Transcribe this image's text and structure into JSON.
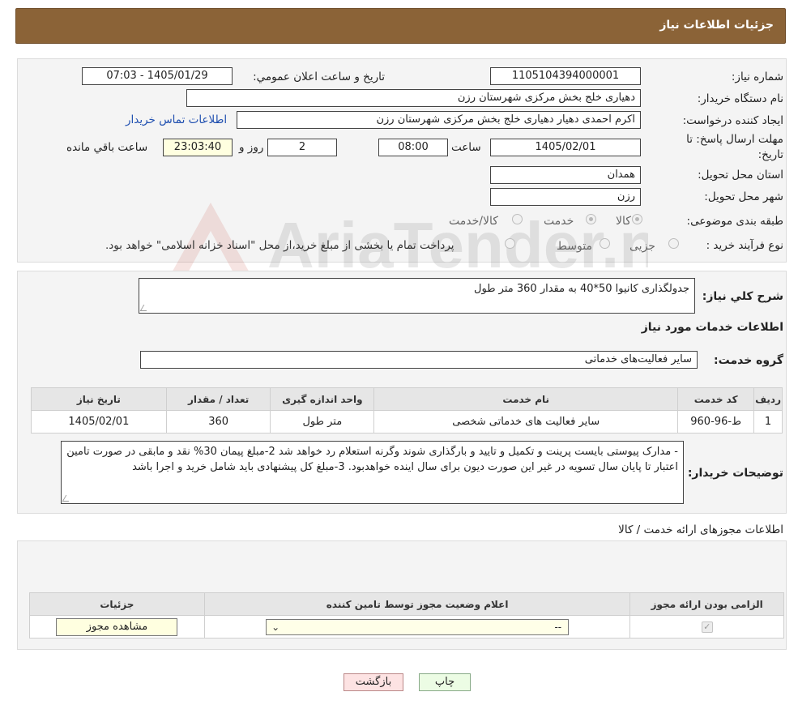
{
  "header": {
    "title": "جزئیات اطلاعات نیاز"
  },
  "form": {
    "need_number_label": "شماره نیاز:",
    "need_number": "1105104394000001",
    "announce_label": "تاریخ و ساعت اعلان عمومي:",
    "announce_value": "1405/01/29 - 07:03",
    "buyer_org_label": "نام دستگاه خريدار:",
    "buyer_org": "دهیاری خلج بخش مرکزی شهرستان رزن",
    "requester_label": "ايجاد کننده درخواست:",
    "requester": "اکرم احمدی دهیار دهیاری خلج بخش مرکزی شهرستان رزن",
    "contact_link": "اطلاعات تماس خریدار",
    "deadline_label_line1": "مهلت ارسال پاسخ: تا",
    "deadline_label_line2": "تاريخ:",
    "deadline_date": "1405/02/01",
    "hour_label": "ساعت",
    "deadline_time": "08:00",
    "days_value": "2",
    "days_label": "روز و",
    "remaining_time": "23:03:40",
    "remaining_label": "ساعت باقي مانده",
    "province_label": "استان محل تحويل:",
    "province": "همدان",
    "city_label": "شهر محل تحويل:",
    "city": "رزن",
    "category_label": "طبقه بندی موضوعی:",
    "category_options": [
      "کالا",
      "خدمت",
      "کالا/خدمت"
    ],
    "process_label": "نوع فرآيند خريد :",
    "process_options": [
      "جزیی",
      "متوسط"
    ],
    "process_note": "پرداخت تمام یا بخشی از مبلغ خرید،از محل \"اسناد خزانه اسلامی\" خواهد بود."
  },
  "details": {
    "summary_label": "شرح کلي نياز:",
    "summary": "جدولگذاری کانیوا 50*40 به مقدار 360 متر طول",
    "services_title": "اطلاعات خدمات مورد نياز",
    "service_group_label": "گروه خدمت:",
    "service_group": "ساير فعاليت‌هاى خدماتى",
    "table": {
      "headers": [
        "رديف",
        "کد خدمت",
        "نام خدمت",
        "واحد اندازه گيری",
        "تعداد / مقدار",
        "تاريخ نياز"
      ],
      "rows": [
        [
          "1",
          "ط-96-960",
          "سایر فعالیت های خدماتی شخصی",
          "متر طول",
          "360",
          "1405/02/01"
        ]
      ]
    },
    "buyer_notes_label": "توضيحات خريدار:",
    "buyer_notes": "- مدارک پیوستی بایست پرینت و تکمیل و تایید و بارگذاری شوند وگرنه استعلام رد خواهد شد 2-مبلغ پیمان 30% نقد و مابقی در صورت تامین اعتبار تا پایان سال تسویه در غیر این صورت دیون برای سال اینده خواهدبود. 3-مبلغ کل پیشنهادی باید شامل خرید و اجرا باشد"
  },
  "licenses": {
    "section_title": "اطلاعات مجوزهای ارائه خدمت / کالا",
    "headers": [
      "الزامی بودن ارائه مجوز",
      "اعلام وضعیت مجوز توسط تامین کننده",
      "جزئیات"
    ],
    "select_value": "--",
    "view_button": "مشاهده مجوز"
  },
  "buttons": {
    "print": "چاپ",
    "back": "بازگشت"
  },
  "watermark": "AriaTender.neT",
  "colors": {
    "header_bg": "#8b6337",
    "link": "#1f4fb0",
    "back_btn_bg": "#fde3e3",
    "print_btn_bg": "#ecfce4"
  }
}
